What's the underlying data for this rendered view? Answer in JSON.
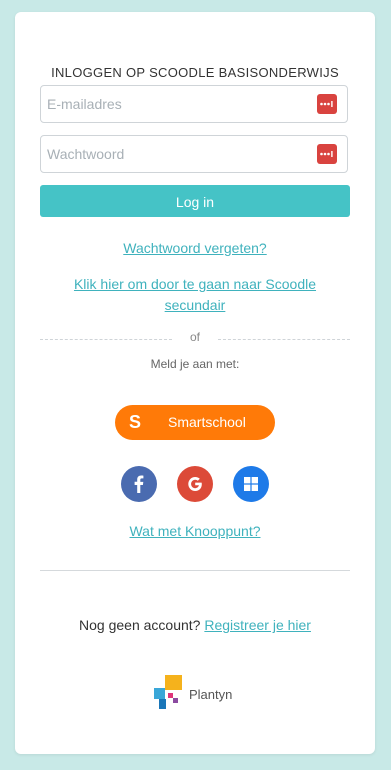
{
  "login": {
    "title": "INLOGGEN OP SCOODLE BASISONDERWIJS",
    "email_placeholder": "E-mailadres",
    "password_placeholder": "Wachtwoord",
    "login_button": "Log in",
    "forgot_password": "Wachtwoord vergeten?",
    "secondary_line1": "Klik hier om door te gaan naar Scoodle",
    "secondary_line2": "secundair",
    "or_text": "of",
    "sign_in_with": "Meld je aan met:",
    "knooppunt_link": "Wat met Knooppunt?"
  },
  "providers": {
    "smartschool_letter": "S",
    "smartschool_label": "Smartschool",
    "social_icons": [
      "facebook-icon",
      "google-icon",
      "windows-icon"
    ]
  },
  "register": {
    "text": "Nog geen account?",
    "link": "Registreer je hier"
  },
  "brand": {
    "name": "Plantyn"
  },
  "colors": {
    "background": "#c8e9e7",
    "accent": "#45c3c6",
    "link": "#3fb2bd",
    "smartschool": "#ff7a08",
    "facebook": "#4a6bb0",
    "google": "#dc4a38",
    "windows": "#1e7ae8",
    "password_icon": "#d9433f"
  }
}
